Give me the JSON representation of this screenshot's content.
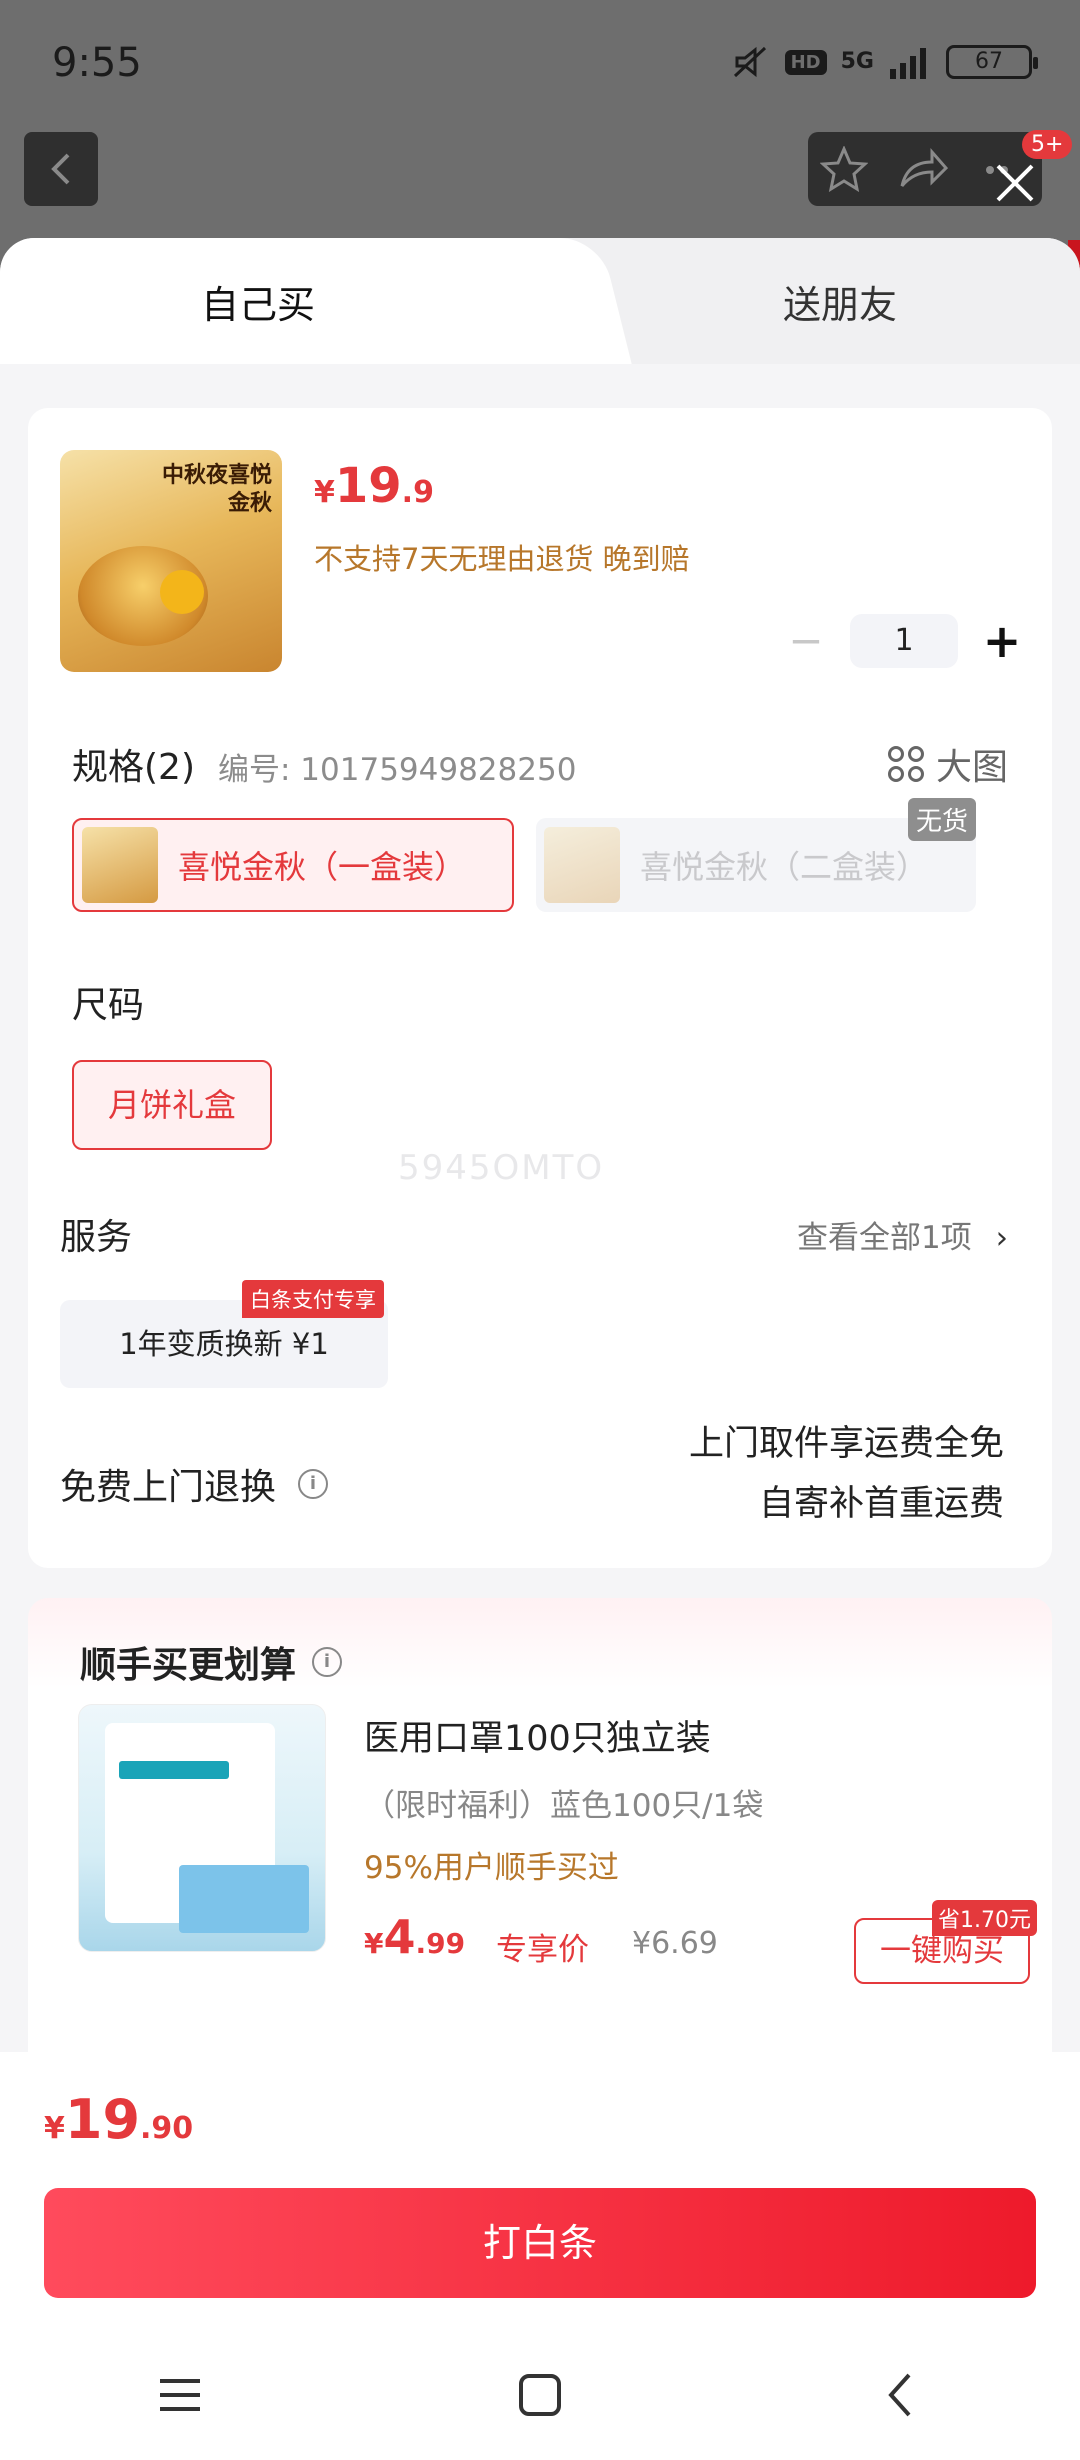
{
  "status_bar": {
    "time": "9:55",
    "hd": "HD",
    "network": "5G",
    "battery": "67"
  },
  "top_bar": {
    "message_badge": "5+"
  },
  "tabs": [
    {
      "label": "自己买"
    },
    {
      "label": "送朋友"
    }
  ],
  "product": {
    "thumb_text": "中秋夜喜悦金秋",
    "price_currency": "¥",
    "price_int": "19",
    "price_dec": ".9",
    "notice": "不支持7天无理由退货  晚到赔",
    "quantity": "1"
  },
  "spec": {
    "title": "规格(2)",
    "code_label": "编号: 10175949828250",
    "big_image_label": "大图",
    "options": [
      {
        "label": "喜悦金秋（一盒装）",
        "selected": true
      },
      {
        "label": "喜悦金秋（二盒装）",
        "selected": false,
        "badge": "无货"
      }
    ]
  },
  "size": {
    "title": "尺码",
    "options": [
      {
        "label": "月饼礼盒"
      }
    ]
  },
  "watermark": "5945OMTO",
  "service": {
    "title": "服务",
    "view_all": "查看全部1项",
    "item": "1年变质换新  ¥1",
    "item_tag": "白条支付专享"
  },
  "return_service": {
    "title": "免费上门退换",
    "line1": "上门取件享运费全免",
    "line2": "自寄补首重运费"
  },
  "bundle": {
    "title": "顺手买更划算",
    "item": {
      "title": "医用口罩100只独立装",
      "spec": "（限时福利）蓝色100只/1袋",
      "note": "95%用户顺手买过",
      "price_currency": "¥",
      "price_int": "4",
      "price_dec": ".99",
      "price_label": "专享价",
      "original_price": "¥6.69",
      "buy_button": "一键购买",
      "save_tag": "省1.70元"
    }
  },
  "footer": {
    "total_currency": "¥",
    "total_int": "19",
    "total_dec": ".90",
    "pay_button": "打白条"
  },
  "colors": {
    "accent": "#e4393c",
    "note": "#b7772b"
  }
}
